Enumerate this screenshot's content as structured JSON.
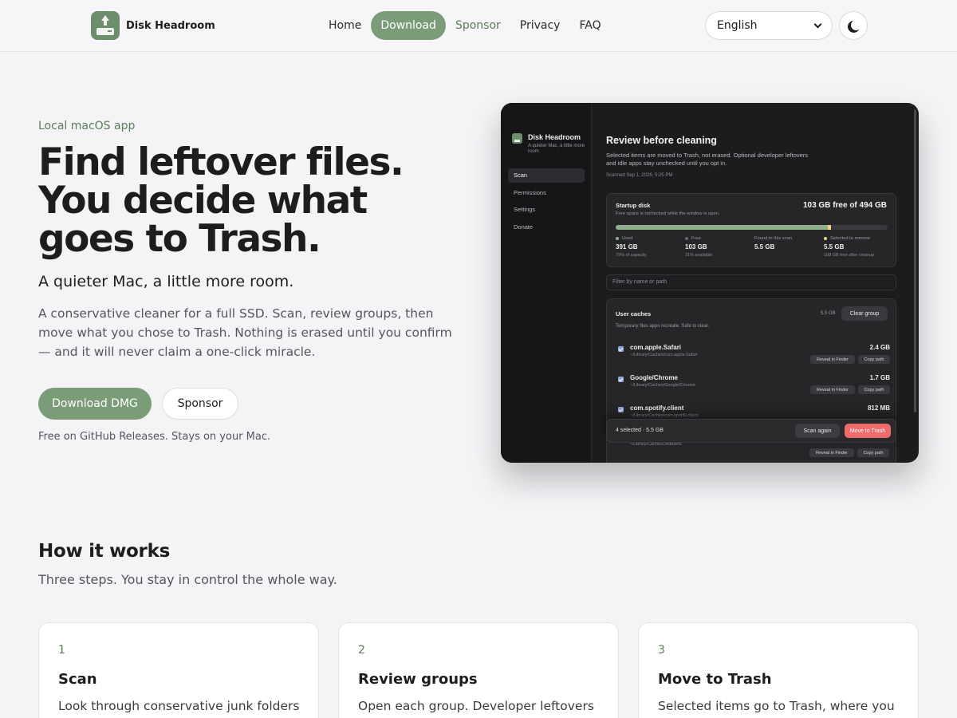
{
  "header": {
    "brand_name": "Disk Headroom",
    "nav": [
      "Home",
      "Download",
      "Sponsor",
      "Privacy",
      "FAQ"
    ],
    "language": "English"
  },
  "hero": {
    "eyebrow": "Local macOS app",
    "title": "Find leftover files. You decide what goes to Trash.",
    "subtitle": "A quieter Mac, a little more room.",
    "description": "A conservative cleaner for a full SSD. Scan, review groups, then move what you chose to Trash. Nothing is erased until you confirm — and it will never claim a one-click miracle.",
    "primary_button": "Download DMG",
    "secondary_button": "Sponsor",
    "note": "Free on GitHub Releases. Stays on your Mac."
  },
  "app": {
    "name": "Disk Headroom",
    "tagline": "A quieter Mac, a little more room.",
    "nav": [
      "Scan",
      "Permissions",
      "Settings",
      "Donate"
    ],
    "title": "Review before cleaning",
    "description": "Selected items are moved to Trash, not erased. Optional developer leftovers and idle apps stay unchecked until you opt in.",
    "scanned": "Scanned Sep 1, 2026, 5:25 PM",
    "disk": {
      "label": "Startup disk",
      "note": "Free space is rechecked while the window is open.",
      "free": "103 GB free of 494 GB",
      "used_fraction": 0.791,
      "selected_fraction": 0.011,
      "stats": [
        {
          "key": "Used",
          "value": "391 GB",
          "sub": "79% of capacity",
          "color": "#8fb08d"
        },
        {
          "key": "Free",
          "value": "103 GB",
          "sub": "21% available",
          "color": "#6a6a70"
        },
        {
          "key": "Found in this scan",
          "value": "5.5 GB",
          "sub": "",
          "color": ""
        },
        {
          "key": "Selected to remove",
          "value": "5.5 GB",
          "sub": "108 GB free after cleanup",
          "color": "#e9d58a"
        }
      ]
    },
    "filter_placeholder": "Filter by name or path",
    "group": {
      "title": "User caches",
      "note": "Temporary files apps recreate. Safe to clear.",
      "size": "5.5 GB",
      "clear": "Clear group",
      "items": [
        {
          "name": "com.apple.Safari",
          "path": "~/Library/Caches/com.apple.Safari",
          "size": "2.4 GB"
        },
        {
          "name": "Google/Chrome",
          "path": "~/Library/Caches/Google/Chrome",
          "size": "1.7 GB"
        },
        {
          "name": "com.spotify.client",
          "path": "~/Library/Caches/com.spotify.client",
          "size": "812 MB"
        }
      ],
      "reveal": "Reveal in Finder",
      "copy": "Copy path",
      "hidden_path": "~/Library/Caches/Jetbrains"
    },
    "footer": {
      "selected": "4 selected · 5.5 GB",
      "scan_again": "Scan again",
      "move": "Move to Trash"
    }
  },
  "how": {
    "title": "How it works",
    "subtitle": "Three steps. You stay in control the whole way.",
    "steps": [
      {
        "num": "1",
        "title": "Scan",
        "text": "Look through conservative junk folders"
      },
      {
        "num": "2",
        "title": "Review groups",
        "text": "Open each group. Developer leftovers"
      },
      {
        "num": "3",
        "title": "Move to Trash",
        "text": "Selected items go to Trash, where you"
      }
    ]
  }
}
